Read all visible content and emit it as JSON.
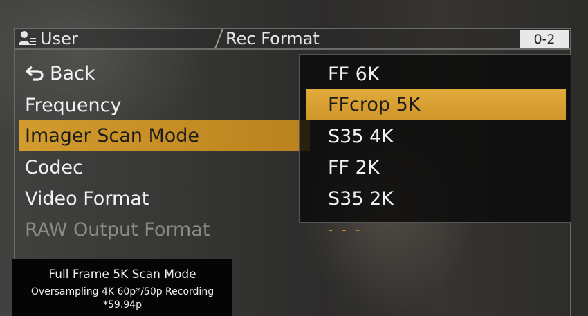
{
  "header": {
    "user_label": "User",
    "title": "Rec Format",
    "page_indicator": "0-2"
  },
  "menu": {
    "items": [
      {
        "label": "Back",
        "icon": "back-arrow-icon",
        "state": "normal"
      },
      {
        "label": "Frequency",
        "state": "normal"
      },
      {
        "label": "Imager Scan Mode",
        "state": "selected"
      },
      {
        "label": "Codec",
        "state": "normal"
      },
      {
        "label": "Video Format",
        "state": "normal"
      },
      {
        "label": "RAW Output Format",
        "state": "disabled"
      }
    ]
  },
  "submenu": {
    "options": [
      {
        "label": "FF 6K",
        "state": "normal"
      },
      {
        "label": "FFcrop 5K",
        "state": "selected"
      },
      {
        "label": "S35 4K",
        "state": "normal"
      },
      {
        "label": "FF 2K",
        "state": "normal"
      },
      {
        "label": "S35 2K",
        "state": "normal"
      }
    ],
    "raw_value": "- - -"
  },
  "info": {
    "title": "Full Frame 5K Scan Mode",
    "line1": "Oversampling 4K 60p*/50p Recording",
    "line2": "*59.94p"
  },
  "colors": {
    "accent": "#d29b2e",
    "menu_text": "#f2f2f2",
    "disabled_text": "#8a8a88"
  }
}
